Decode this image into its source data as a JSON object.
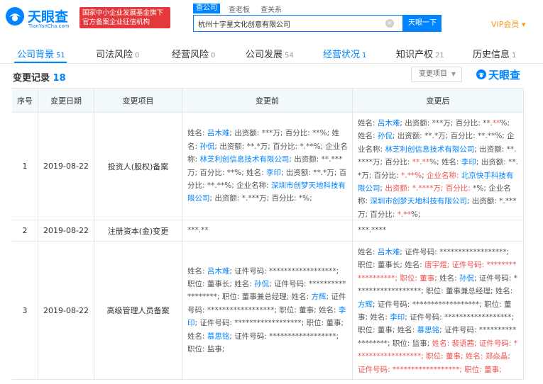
{
  "header": {
    "logo_text": "天眼查",
    "logo_sub": "TianYanCha.com",
    "badge_line1": "国家中小企业发展基金旗下",
    "badge_line2": "官方备案企业征信机构",
    "search_tabs": [
      "查公司",
      "查老板",
      "查关系"
    ],
    "search_value": "杭州十字星文化创意有限公司",
    "search_button": "天眼一下",
    "vip_label": "VIP会员 ▾"
  },
  "nav": {
    "items": [
      {
        "label": "公司背景",
        "count": "51"
      },
      {
        "label": "司法风险",
        "count": "0"
      },
      {
        "label": "经营风险",
        "count": "0"
      },
      {
        "label": "公司发展",
        "count": "54"
      },
      {
        "label": "经营状况",
        "count": "1"
      },
      {
        "label": "知识产权",
        "count": "21"
      },
      {
        "label": "历史信息",
        "count": "1"
      }
    ]
  },
  "section": {
    "title": "变更记录",
    "count": "18",
    "filter_label": "变更项目",
    "watermark": "天眼查"
  },
  "table": {
    "headers": [
      "序号",
      "变更日期",
      "变更项目",
      "变更前",
      "变更后"
    ],
    "rows": [
      {
        "index": "1",
        "date": "2019-08-22",
        "item": "投资人(股权)备案",
        "before": [
          {
            "t": "姓名: "
          },
          {
            "t": "吕木难",
            "c": "blue"
          },
          {
            "t": "; 出资额: ***万; 百分比: **%; 姓名: "
          },
          {
            "t": "孙侃",
            "c": "blue"
          },
          {
            "t": "; 出资额: **.*万; 百分比: *.**%; 企业名称: "
          },
          {
            "t": "林芝利创信息技术有限公司",
            "c": "blue"
          },
          {
            "t": "; 出资额: **.***万; 百分比: **%; 姓名: "
          },
          {
            "t": "李印",
            "c": "blue"
          },
          {
            "t": "; 出资额: **.*万; 百分比: **.**%; 企业名称: "
          },
          {
            "t": "深圳市创梦天地科技有限公司",
            "c": "blue"
          },
          {
            "t": "; 出资额: *.***万; 百分比: *%;"
          }
        ],
        "after": [
          {
            "t": "姓名: "
          },
          {
            "t": "吕木难",
            "c": "blue"
          },
          {
            "t": "; 出资额: ***万; 百分比: **."
          },
          {
            "t": "**",
            "c": "red"
          },
          {
            "t": "%; 姓名: "
          },
          {
            "t": "孙侃",
            "c": "blue"
          },
          {
            "t": "; 出资额: **.*万; 百分比: **.**%; 企业名称: "
          },
          {
            "t": "林芝利创信息技术有限公司",
            "c": "blue"
          },
          {
            "t": "; 出资额: **.****万; 百分比: "
          },
          {
            "t": "**.**",
            "c": "red"
          },
          {
            "t": "%; 姓名: "
          },
          {
            "t": "李印",
            "c": "blue"
          },
          {
            "t": "; 出资额: **.*万; 百分比: "
          },
          {
            "t": "*.**%",
            "c": "red"
          },
          {
            "t": "; "
          },
          {
            "t": "企业名称: ",
            "c": "red"
          },
          {
            "t": "北京快手科技有限公司",
            "c": "blue"
          },
          {
            "t": "; "
          },
          {
            "t": "出资额: *.****万; 百分比: ",
            "c": "red"
          },
          {
            "t": "*%; 企业名称: "
          },
          {
            "t": "深圳市创梦天地科技有限公司",
            "c": "blue"
          },
          {
            "t": "; 出资额: *.***万; 百分比: "
          },
          {
            "t": "*.**",
            "c": "red"
          },
          {
            "t": "%;"
          }
        ]
      },
      {
        "index": "2",
        "date": "2019-08-22",
        "item": "注册资本(金)变更",
        "before": [
          {
            "t": "***.**"
          }
        ],
        "after": [
          {
            "t": "***.****"
          }
        ]
      },
      {
        "index": "3",
        "date": "2019-08-22",
        "item": "高级管理人员备案",
        "before": [
          {
            "t": "姓名: "
          },
          {
            "t": "吕木难",
            "c": "blue"
          },
          {
            "t": "; 证件号码: ******************; 职位: 董事长; 姓名: "
          },
          {
            "t": "孙侃",
            "c": "blue"
          },
          {
            "t": "; 证件号码: ******************; 职位: 董事兼总经理; 姓名: "
          },
          {
            "t": "方辉",
            "c": "blue"
          },
          {
            "t": "; 证件号码: ******************; 职位: 董事; 姓名: "
          },
          {
            "t": "李印",
            "c": "blue"
          },
          {
            "t": "; 证件号码: ******************; 职位: 董事; 姓名: "
          },
          {
            "t": "慕思铭",
            "c": "blue"
          },
          {
            "t": "; 证件号码: ******************; 职位: 监事;"
          }
        ],
        "after": [
          {
            "t": "姓名: "
          },
          {
            "t": "吕木难",
            "c": "blue"
          },
          {
            "t": "; 证件号码: ******************; 职位: 董事长; 姓名: "
          },
          {
            "t": "唐宇煜",
            "c": "red"
          },
          {
            "t": "; 证件号码: ******************; 职位: 董事",
            "c": "red"
          },
          {
            "t": "; 姓名: "
          },
          {
            "t": "孙侃",
            "c": "blue"
          },
          {
            "t": "; 证件号码: ******************; 职位: 董事兼总经理; 姓名: "
          },
          {
            "t": "方辉",
            "c": "blue"
          },
          {
            "t": "; 证件号码: ******************; 职位: 董事; 姓名: "
          },
          {
            "t": "李印",
            "c": "blue"
          },
          {
            "t": "; 证件号码: ******************; 职位: 董事; 姓名: "
          },
          {
            "t": "慕思铭",
            "c": "blue"
          },
          {
            "t": "; 证件号码: ******************; 职位: 监事; "
          },
          {
            "t": "姓名: 裴语茜; 证件号码: ******************; 职位: 董事; 姓名: 郑焱晶; 证件号码: ******************; 职位: 董事;",
            "c": "red"
          }
        ]
      }
    ]
  }
}
